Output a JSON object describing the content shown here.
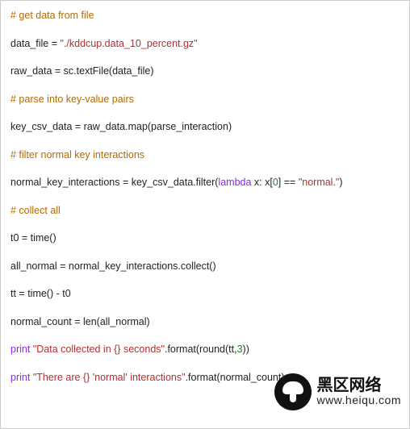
{
  "code": {
    "c1": "# get data from file",
    "l2a": "data_file = ",
    "l2b": "\"./kddcup.data_10_percent.gz\"",
    "l3": "raw_data = sc.textFile(data_file)",
    "c4": "# parse into key-value pairs",
    "l5": "key_csv_data = raw_data.map(parse_interaction)",
    "c6": "# filter normal key interactions",
    "l7a": "normal_key_interactions = key_csv_data.filter(",
    "l7b": "lambda",
    "l7c": " x: x[",
    "l7d": "0",
    "l7e": "] == ",
    "l7f": "\"normal.\"",
    "l7g": ")",
    "c8": "# collect all",
    "l9": "t0 = time()",
    "l10": "all_normal = normal_key_interactions.collect()",
    "l11": "tt = time() - t0",
    "l12": "normal_count = len(all_normal)",
    "l13a": "print",
    "l13b": " ",
    "l13c": "\"Data collected in {} seconds\"",
    "l13d": ".format(round(tt,",
    "l13e": "3",
    "l13f": "))",
    "l14a": "print",
    "l14b": " ",
    "l14c": "\"There are {} 'normal' interactions\"",
    "l14d": ".format(normal_count)"
  },
  "watermark": {
    "line1": "黑区网络",
    "line2": "www.heiqu.com"
  }
}
